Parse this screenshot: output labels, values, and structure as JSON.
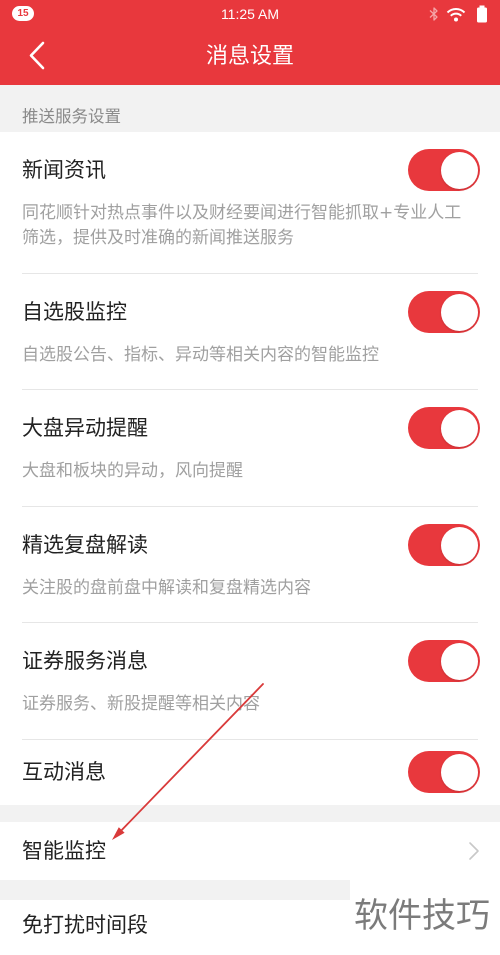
{
  "colors": {
    "accent": "#e8383d",
    "background": "#f2f2f2"
  },
  "status_bar": {
    "notification_count": "15",
    "time": "11:25 AM",
    "icons": [
      "bluetooth-icon",
      "wifi-icon",
      "battery-icon"
    ]
  },
  "header": {
    "back_icon": "chevron-left-icon",
    "title": "消息设置"
  },
  "push_section": {
    "label": "推送服务设置",
    "items": [
      {
        "title": "新闻资讯",
        "desc": "同花顺针对热点事件以及财经要闻进行智能抓取+专业人工筛选，提供及时准确的新闻推送服务",
        "enabled": true
      },
      {
        "title": "自选股监控",
        "desc": "自选股公告、指标、异动等相关内容的智能监控",
        "enabled": true
      },
      {
        "title": "大盘异动提醒",
        "desc": "大盘和板块的异动，风向提醒",
        "enabled": true
      },
      {
        "title": "精选复盘解读",
        "desc": "关注股的盘前盘中解读和复盘精选内容",
        "enabled": true
      },
      {
        "title": "证券服务消息",
        "desc": "证券服务、新股提醒等相关内容",
        "enabled": true
      },
      {
        "title": "互动消息",
        "enabled": true
      }
    ]
  },
  "smart_monitor": {
    "label": "智能监控",
    "icon": "chevron-right-icon"
  },
  "do_not_disturb": {
    "label": "免打扰时间段"
  },
  "watermark": {
    "text": "软件技巧"
  }
}
